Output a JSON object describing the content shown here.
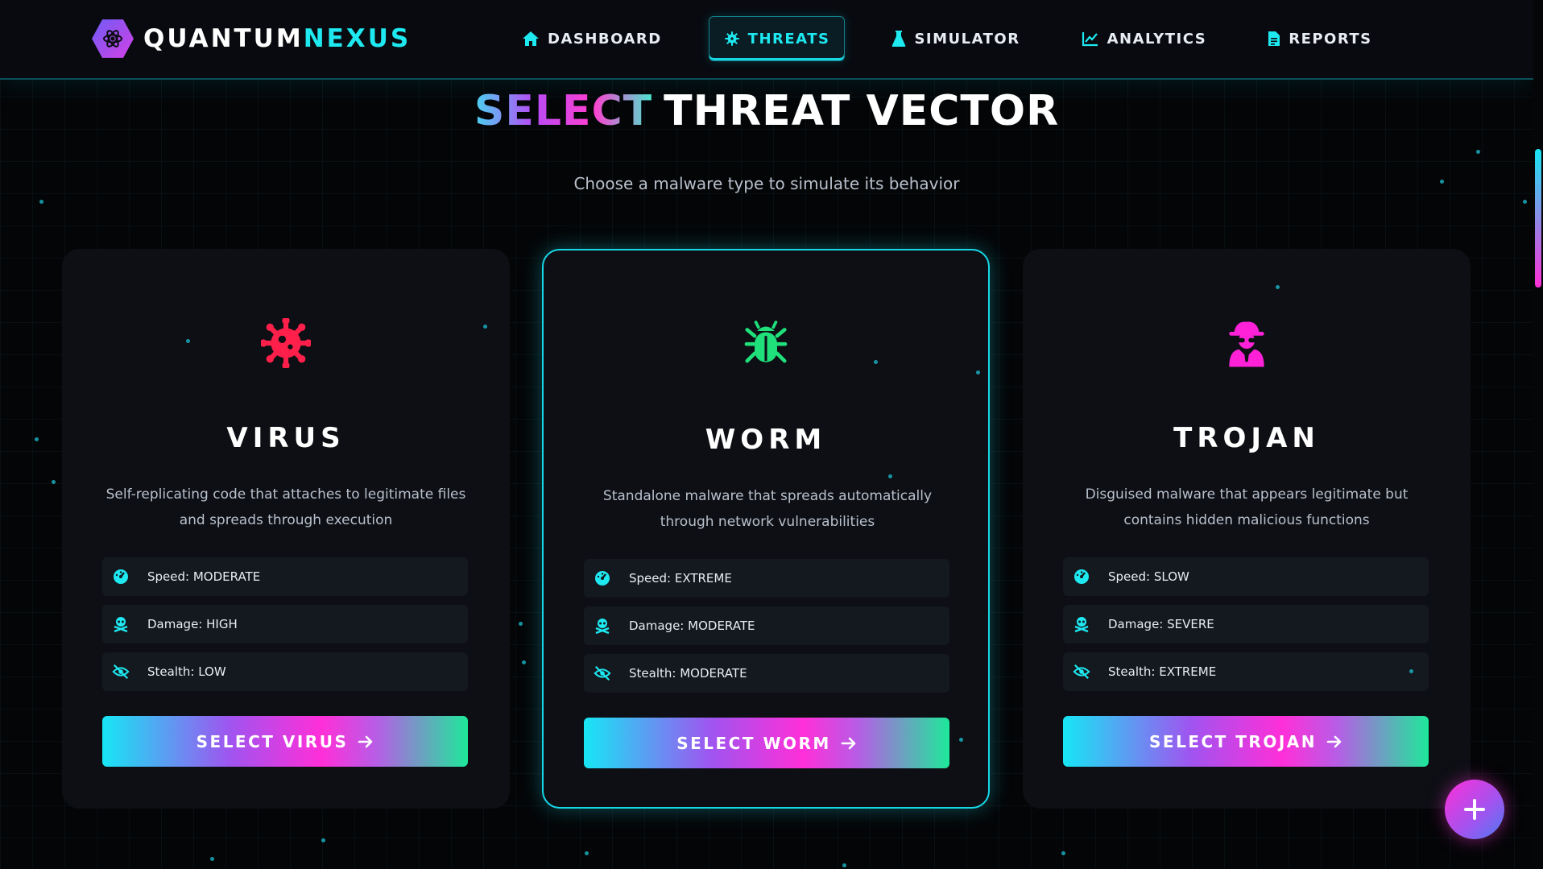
{
  "brand": {
    "name_part1": "QUANTUM",
    "name_part2": "NEXUS"
  },
  "nav": [
    {
      "label": "DASHBOARD",
      "icon": "home-icon",
      "active": false
    },
    {
      "label": "THREATS",
      "icon": "virus-icon",
      "active": true
    },
    {
      "label": "SIMULATOR",
      "icon": "flask-icon",
      "active": false
    },
    {
      "label": "ANALYTICS",
      "icon": "line-chart-icon",
      "active": false
    },
    {
      "label": "REPORTS",
      "icon": "file-icon",
      "active": false
    }
  ],
  "hero": {
    "title_highlight": "SELECT",
    "title_rest": "THREAT VECTOR",
    "subtitle": "Choose a malware type to simulate its behavior"
  },
  "cards": [
    {
      "title": "VIRUS",
      "icon": "virus-icon",
      "icon_color": "#ff1f4b",
      "description": "Self-replicating code that attaches to legitimate files and spreads through execution",
      "stats": [
        {
          "label": "Speed:",
          "value": "MODERATE",
          "icon": "speedometer-icon"
        },
        {
          "label": "Damage:",
          "value": "HIGH",
          "icon": "skull-crossbones-icon"
        },
        {
          "label": "Stealth:",
          "value": "LOW",
          "icon": "eye-slash-icon"
        }
      ],
      "button": "SELECT VIRUS"
    },
    {
      "title": "WORM",
      "icon": "bug-icon",
      "icon_color": "#1fe07a",
      "description": "Standalone malware that spreads automatically through network vulnerabilities",
      "stats": [
        {
          "label": "Speed:",
          "value": "EXTREME",
          "icon": "speedometer-icon"
        },
        {
          "label": "Damage:",
          "value": "MODERATE",
          "icon": "skull-crossbones-icon"
        },
        {
          "label": "Stealth:",
          "value": "MODERATE",
          "icon": "eye-slash-icon"
        }
      ],
      "button": "SELECT WORM"
    },
    {
      "title": "TROJAN",
      "icon": "user-secret-icon",
      "icon_color": "#ff21d8",
      "description": "Disguised malware that appears legitimate but contains hidden malicious functions",
      "stats": [
        {
          "label": "Speed:",
          "value": "SLOW",
          "icon": "speedometer-icon"
        },
        {
          "label": "Damage:",
          "value": "SEVERE",
          "icon": "skull-crossbones-icon"
        },
        {
          "label": "Stealth:",
          "value": "EXTREME",
          "icon": "eye-slash-icon"
        }
      ],
      "button": "SELECT TROJAN"
    }
  ],
  "fab": {
    "icon": "plus-icon"
  },
  "colors": {
    "accent_cyan": "#1ee8f0",
    "accent_magenta": "#ff2fd8",
    "accent_green": "#1ee89a",
    "background": "#040507",
    "card": "#0d0f14"
  }
}
